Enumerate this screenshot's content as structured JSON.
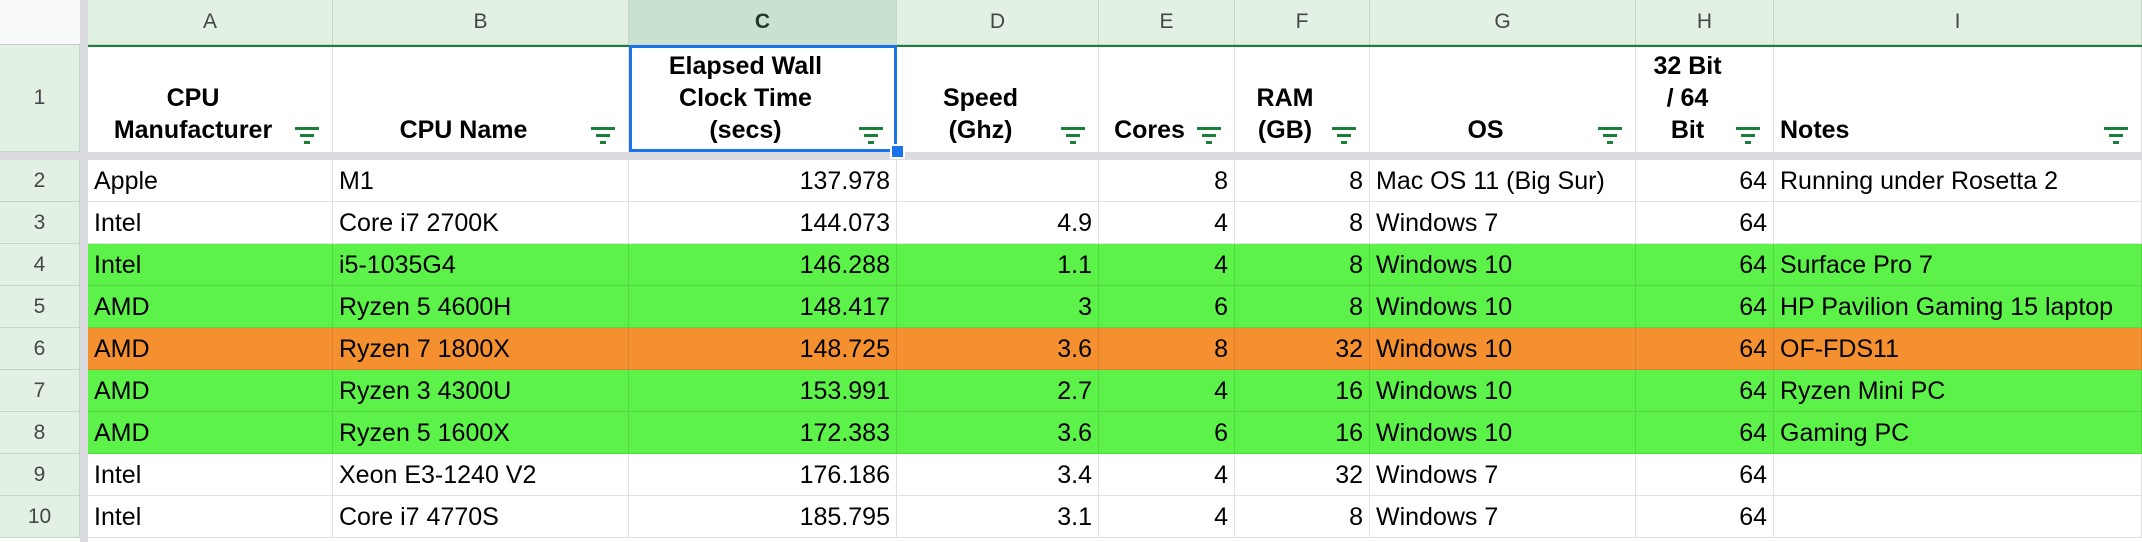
{
  "sheet": {
    "columns": [
      "A",
      "B",
      "C",
      "D",
      "E",
      "F",
      "G",
      "H",
      "I"
    ],
    "selected_column": "C",
    "row_numbers": [
      "1",
      "2",
      "3",
      "4",
      "5",
      "6",
      "7",
      "8",
      "9",
      "10"
    ],
    "headers": [
      "CPU\nManufacturer",
      "CPU Name",
      "Elapsed Wall\nClock Time\n(secs)",
      "Speed\n(Ghz)",
      "Cores",
      "RAM\n(GB)",
      "OS",
      "32 Bit\n/ 64\nBit",
      "Notes"
    ],
    "colors": {
      "green": "#5cf24a",
      "orange": "#f4902f",
      "selection": "#1a73e8",
      "header_bg": "#e3f1e5",
      "filter_icon": "#188038"
    },
    "rows": [
      {
        "highlight": "none",
        "cells": [
          "Apple",
          "M1",
          "137.978",
          "",
          "8",
          "8",
          "Mac OS 11 (Big Sur)",
          "64",
          "Running under Rosetta 2"
        ]
      },
      {
        "highlight": "none",
        "cells": [
          "Intel",
          "Core i7 2700K",
          "144.073",
          "4.9",
          "4",
          "8",
          "Windows 7",
          "64",
          ""
        ]
      },
      {
        "highlight": "green",
        "cells": [
          "Intel",
          "i5-1035G4",
          "146.288",
          "1.1",
          "4",
          "8",
          "Windows 10",
          "64",
          "Surface Pro 7"
        ]
      },
      {
        "highlight": "green",
        "cells": [
          "AMD",
          "Ryzen 5 4600H",
          "148.417",
          "3",
          "6",
          "8",
          "Windows 10",
          "64",
          "HP Pavilion Gaming 15 laptop"
        ]
      },
      {
        "highlight": "orange",
        "cells": [
          "AMD",
          "Ryzen 7 1800X",
          "148.725",
          "3.6",
          "8",
          "32",
          "Windows 10",
          "64",
          "OF-FDS11"
        ]
      },
      {
        "highlight": "green",
        "cells": [
          "AMD",
          "Ryzen 3 4300U",
          "153.991",
          "2.7",
          "4",
          "16",
          "Windows 10",
          "64",
          "Ryzen Mini PC"
        ]
      },
      {
        "highlight": "green",
        "cells": [
          "AMD",
          "Ryzen 5 1600X",
          "172.383",
          "3.6",
          "6",
          "16",
          "Windows 10",
          "64",
          "Gaming PC"
        ]
      },
      {
        "highlight": "none",
        "cells": [
          "Intel",
          "Xeon E3-1240 V2",
          "176.186",
          "3.4",
          "4",
          "32",
          "Windows 7",
          "64",
          ""
        ]
      },
      {
        "highlight": "none",
        "cells": [
          "Intel",
          "Core i7 4770S",
          "185.795",
          "3.1",
          "4",
          "8",
          "Windows 7",
          "64",
          ""
        ]
      }
    ]
  }
}
